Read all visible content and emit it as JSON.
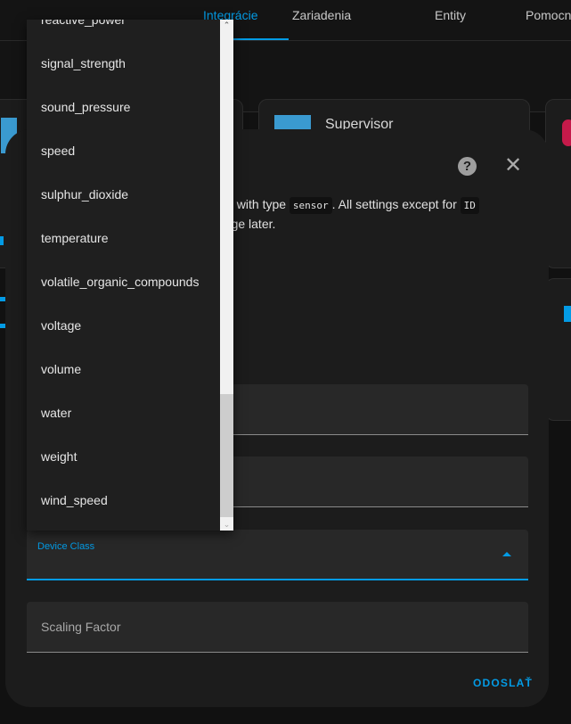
{
  "tabs": [
    {
      "label": "Integrácie",
      "active": true
    },
    {
      "label": "Zariadenia"
    },
    {
      "label": "Entity"
    },
    {
      "label": "Pomocn"
    }
  ],
  "cards": {
    "supervisor": "Supervisor"
  },
  "dialog": {
    "desc_line1_a": "tity with type ",
    "desc_code1": "sensor",
    "desc_line1_b": ". All settings except for ",
    "desc_code2": "ID",
    "desc_line2": "page later.",
    "device_class_label": "Device Class",
    "scaling_factor_placeholder": "Scaling Factor",
    "submit_label": "ODOSLAŤ"
  },
  "dropdown": {
    "items": [
      "reactive_power",
      "signal_strength",
      "sound_pressure",
      "speed",
      "sulphur_dioxide",
      "temperature",
      "volatile_organic_compounds",
      "voltage",
      "volume",
      "water",
      "weight",
      "wind_speed"
    ],
    "scroll_position": 0.95
  },
  "colors": {
    "accent": "#039be5",
    "dialog_bg": "#1c1c1c",
    "page_bg": "#111111"
  }
}
